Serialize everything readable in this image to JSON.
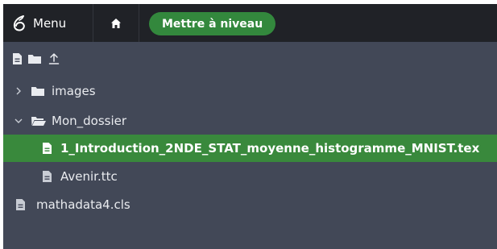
{
  "topbar": {
    "menu_label": "Menu",
    "menu_icon": "overleaf-logo-icon",
    "home_icon": "home-icon",
    "upgrade_label": "Mettre à niveau",
    "upgrade_color": "#33883d"
  },
  "toolbar": {
    "items": [
      {
        "name": "new-file",
        "icon": "file-icon"
      },
      {
        "name": "new-folder",
        "icon": "folder-icon"
      },
      {
        "name": "upload",
        "icon": "upload-icon"
      }
    ]
  },
  "file_tree": {
    "items": [
      {
        "type": "folder",
        "label": "images",
        "expanded": false,
        "level": 0
      },
      {
        "type": "folder",
        "label": "Mon_dossier",
        "expanded": true,
        "level": 0
      },
      {
        "type": "file",
        "label": "1_Introduction_2NDE_STAT_moyenne_histogramme_MNIST.tex",
        "level": 1,
        "selected": true
      },
      {
        "type": "file",
        "label": "Avenir.ttc",
        "level": 1,
        "selected": false
      },
      {
        "type": "file",
        "label": "mathadata4.cls",
        "level": 0,
        "selected": false
      }
    ],
    "selected_color": "#39893c"
  },
  "colors": {
    "topbar_bg": "#202227",
    "panel_bg": "#424857",
    "text": "#e9ebef"
  }
}
